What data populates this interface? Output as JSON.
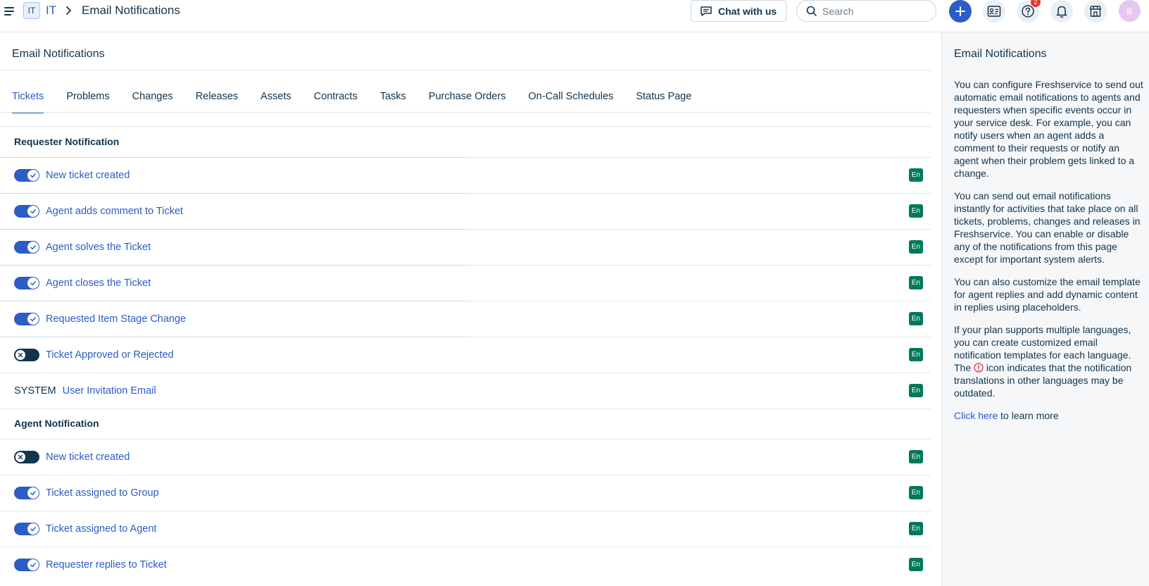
{
  "header": {
    "workspace_badge": "IT",
    "workspace_name": "IT",
    "page_heading": "Email Notifications",
    "chat_label": "Chat with us",
    "search_placeholder": "Search",
    "help_badge_count": "2",
    "avatar_initial": "B"
  },
  "main": {
    "title": "Email Notifications",
    "tabs": [
      {
        "label": "Tickets",
        "active": true
      },
      {
        "label": "Problems"
      },
      {
        "label": "Changes"
      },
      {
        "label": "Releases"
      },
      {
        "label": "Assets"
      },
      {
        "label": "Contracts"
      },
      {
        "label": "Tasks"
      },
      {
        "label": "Purchase Orders"
      },
      {
        "label": "On-Call Schedules"
      },
      {
        "label": "Status Page"
      }
    ],
    "requester_section": {
      "title": "Requester Notification",
      "rows": [
        {
          "label": "New ticket created",
          "enabled": true,
          "lang": "En"
        },
        {
          "label": "Agent adds comment to Ticket",
          "enabled": true,
          "lang": "En"
        },
        {
          "label": "Agent solves the Ticket",
          "enabled": true,
          "lang": "En"
        },
        {
          "label": "Agent closes the Ticket",
          "enabled": true,
          "lang": "En"
        },
        {
          "label": "Requested Item Stage Change",
          "enabled": true,
          "lang": "En"
        },
        {
          "label": "Ticket Approved or Rejected",
          "enabled": false,
          "lang": "En"
        }
      ],
      "system_row": {
        "prefix": "SYSTEM",
        "label": "User Invitation Email",
        "lang": "En"
      }
    },
    "agent_section": {
      "title": "Agent Notification",
      "rows": [
        {
          "label": "New ticket created",
          "enabled": false,
          "lang": "En"
        },
        {
          "label": "Ticket assigned to Group",
          "enabled": true,
          "lang": "En"
        },
        {
          "label": "Ticket assigned to Agent",
          "enabled": true,
          "lang": "En"
        },
        {
          "label": "Requester replies to Ticket",
          "enabled": true,
          "lang": "En"
        }
      ]
    }
  },
  "side_panel": {
    "title": "Email Notifications",
    "p1": "You can configure Freshservice to send out automatic email notifications to agents and requesters when specific events occur in your service desk. For example, you can notify users when an agent adds a comment to their requests or notify an agent when their problem gets linked to a change.",
    "p2": "You can send out email notifications instantly for activities that take place on all tickets, problems, changes and releases in Freshservice. You can enable or disable any of the notifications from this page except for important system alerts.",
    "p3": "You can also customize the email template for agent replies and add dynamic content in replies using placeholders.",
    "p4_before": "If your plan supports multiple languages, you can create customized email notification templates for each language. The",
    "p4_after": "icon indicates that the notification translations in other languages may be outdated.",
    "link_text": "Click here",
    "link_suffix": "to learn more"
  },
  "colors": {
    "accent": "#2c5cc5",
    "text": "#12344d",
    "lang_badge": "#00795b",
    "toggle_off": "#12344d",
    "notification_badge": "#e43538",
    "avatar": "#e8c6f2"
  }
}
